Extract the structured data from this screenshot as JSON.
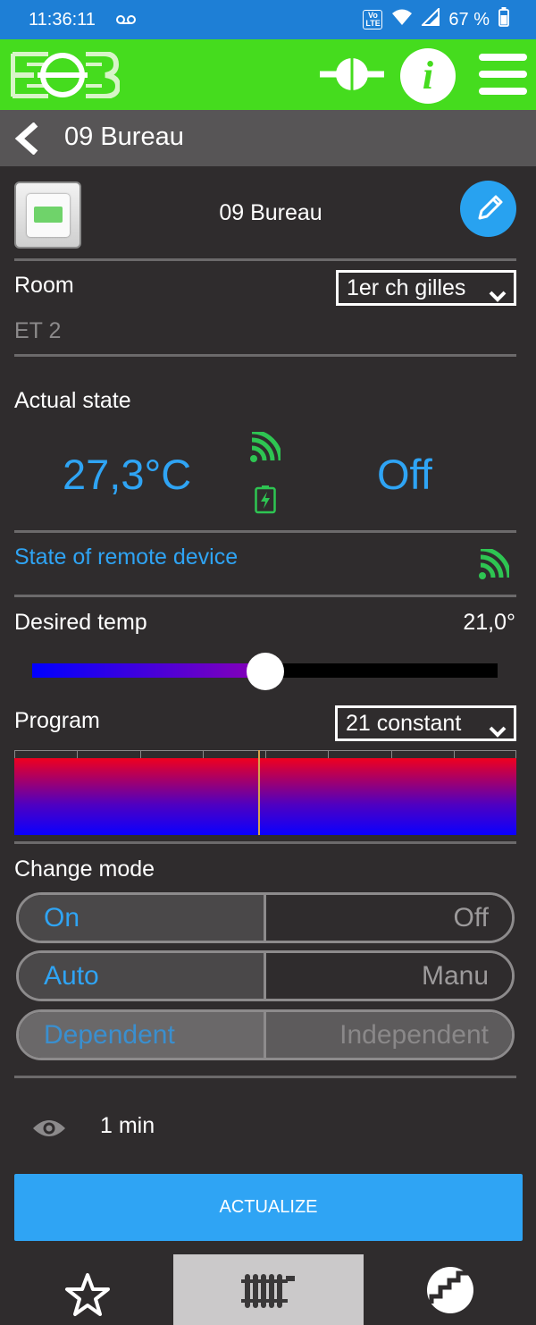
{
  "status_bar": {
    "time": "11:36:11",
    "volte_line1": "Vo",
    "volte_line2": "LTE",
    "battery": "67 %"
  },
  "app_header": {
    "logo_icon": "eob-logo-icon",
    "plug_icon": "plug-icon",
    "info_icon": "i",
    "menu_icon": "hamburger-menu-icon",
    "color": "#45dc1e"
  },
  "title_bar": {
    "back_icon": "chevron-left-icon",
    "title": "09 Bureau"
  },
  "device": {
    "name": "09 Bureau",
    "edit_icon": "pencil-icon"
  },
  "room": {
    "label": "Room",
    "selected": "1er ch gilles",
    "location": "ET 2"
  },
  "actual_state": {
    "label": "Actual state",
    "temperature": "27,3°C",
    "state": "Off",
    "signal_icon": "wifi-signal-icon",
    "battery_icon": "battery-charging-icon"
  },
  "remote": {
    "link_label": "State of remote device",
    "signal_icon": "wifi-signal-icon"
  },
  "desired_temp": {
    "label": "Desired temp",
    "value": "21,0°",
    "slider_fraction": 0.5
  },
  "program": {
    "label": "Program",
    "selected": "21 constant",
    "now_fraction": 0.485
  },
  "change_mode": {
    "label": "Change mode",
    "toggles": [
      {
        "left": "On",
        "right": "Off"
      },
      {
        "left": "Auto",
        "right": "Manu"
      },
      {
        "left": "Dependent",
        "right": "Independent"
      }
    ]
  },
  "refresh": {
    "eye_icon": "eye-icon",
    "interval": "1 min"
  },
  "actualize_button": "ACTUALIZE",
  "bottom_nav": {
    "favorites_icon": "star-icon",
    "radiator_icon": "radiator-icon",
    "stats_icon": "chart-icon"
  },
  "colors": {
    "accent_blue": "#2fa4f4",
    "background": "#2f2c2d",
    "signal_green": "#2ec552"
  }
}
